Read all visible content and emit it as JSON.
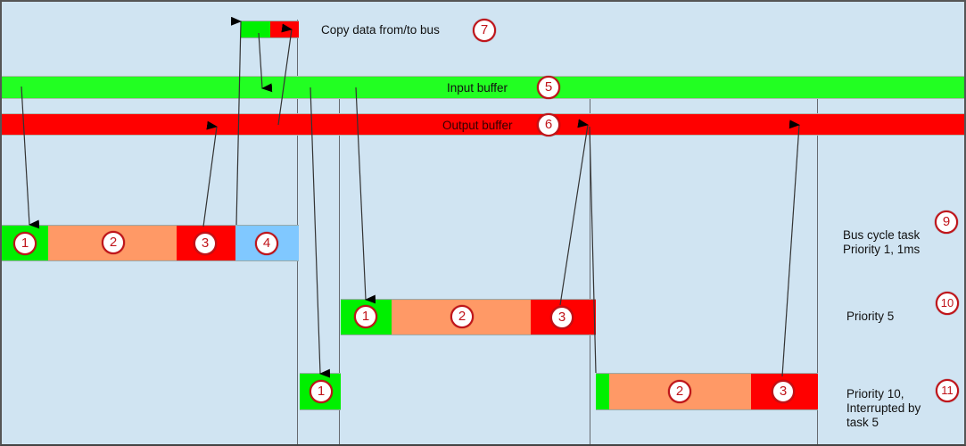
{
  "diagram": {
    "title_label": "Copy data from/to bus",
    "input_buffer_label": "Input buffer",
    "output_buffer_label": "Output buffer",
    "bus_cycle_task_line1": "Bus cycle task",
    "bus_cycle_task_line2": "Priority 1, 1ms",
    "priority5_label": "Priority 5",
    "priority10_line1": "Priority 10,",
    "priority10_line2": "Interrupted by",
    "priority10_line3": "task 5",
    "badges": {
      "copy_data": "7",
      "input_buffer": "5",
      "output_buffer": "6",
      "bus_cycle_task": "9",
      "priority5": "10",
      "priority10": "11"
    },
    "bus_task_steps": [
      "1",
      "2",
      "3",
      "4"
    ],
    "task5_steps": [
      "1",
      "2",
      "3"
    ],
    "task10_steps": [
      "1",
      "2",
      "3"
    ],
    "colors": {
      "background": "#d0e4f2",
      "input_buffer": "#22ff22",
      "output_buffer": "#ff0000",
      "read_step": "#00f000",
      "process_step": "#ff9966",
      "write_step": "#ff0000",
      "copy_step": "#80c8ff",
      "badge_border": "#c0141a"
    }
  }
}
